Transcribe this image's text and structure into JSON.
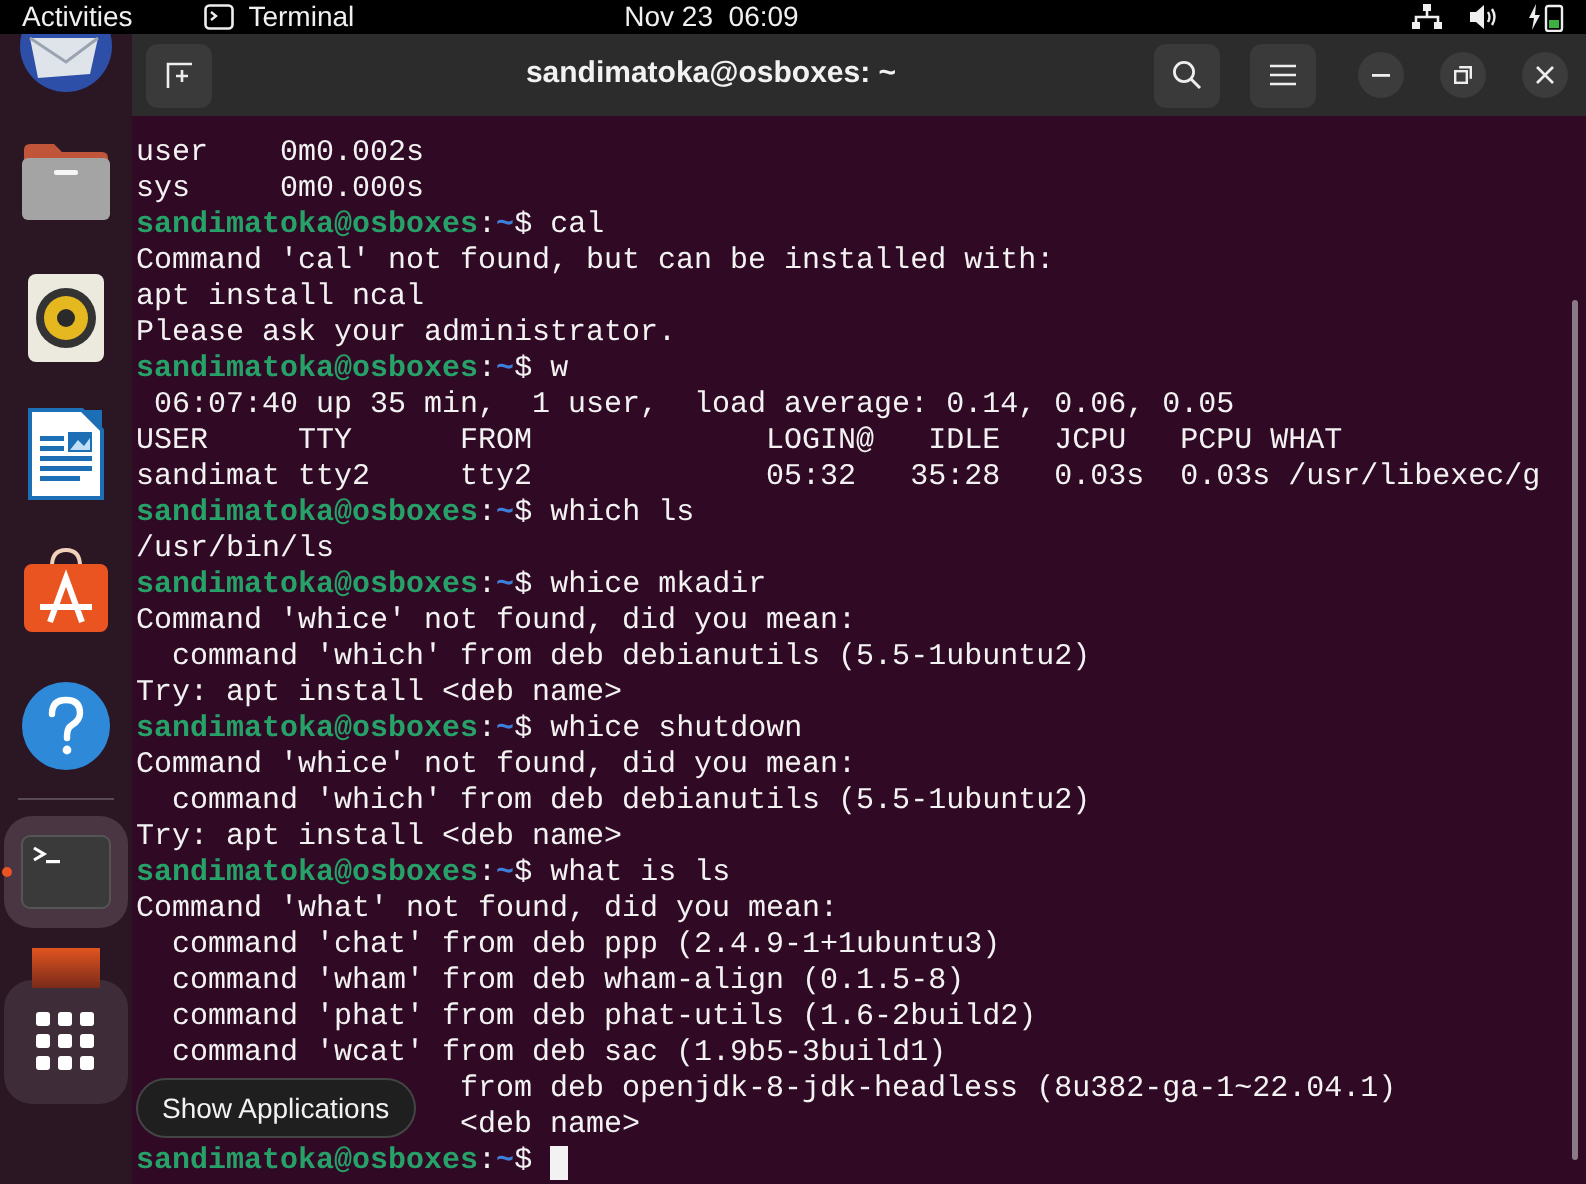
{
  "top_bar": {
    "activities": "Activities",
    "app_name": "Terminal",
    "clock": "Nov 23  06:09"
  },
  "dock": {
    "items": [
      {
        "kind": "mail",
        "running": false
      },
      {
        "kind": "files",
        "running": false
      },
      {
        "kind": "music",
        "running": false
      },
      {
        "kind": "writer",
        "running": false
      },
      {
        "kind": "software",
        "running": false
      },
      {
        "kind": "help",
        "running": false
      },
      {
        "kind": "terminal",
        "running": true
      },
      {
        "kind": "image",
        "running": false
      }
    ],
    "tooltip": "Show Applications"
  },
  "terminal": {
    "title": "sandimatoka@osboxes: ~",
    "lines": [
      {
        "kind": "output",
        "text": "user    0m0.002s"
      },
      {
        "kind": "output",
        "text": "sys     0m0.000s"
      },
      {
        "kind": "prompt",
        "user": "sandimatoka@osboxes",
        "separator": ":",
        "path": "~",
        "symbol": "$",
        "command": "cal"
      },
      {
        "kind": "output",
        "text": "Command 'cal' not found, but can be installed with:"
      },
      {
        "kind": "output",
        "text": "apt install ncal"
      },
      {
        "kind": "output",
        "text": "Please ask your administrator."
      },
      {
        "kind": "prompt",
        "user": "sandimatoka@osboxes",
        "separator": ":",
        "path": "~",
        "symbol": "$",
        "command": "w"
      },
      {
        "kind": "output",
        "text": " 06:07:40 up 35 min,  1 user,  load average: 0.14, 0.06, 0.05"
      },
      {
        "kind": "output",
        "text": "USER     TTY      FROM             LOGIN@   IDLE   JCPU   PCPU WHAT"
      },
      {
        "kind": "output",
        "text": "sandimat tty2     tty2             05:32   35:28   0.03s  0.03s /usr/libexec/g"
      },
      {
        "kind": "prompt",
        "user": "sandimatoka@osboxes",
        "separator": ":",
        "path": "~",
        "symbol": "$",
        "command": "which ls"
      },
      {
        "kind": "output",
        "text": "/usr/bin/ls"
      },
      {
        "kind": "prompt",
        "user": "sandimatoka@osboxes",
        "separator": ":",
        "path": "~",
        "symbol": "$",
        "command": "whice mkadir"
      },
      {
        "kind": "output",
        "text": "Command 'whice' not found, did you mean:"
      },
      {
        "kind": "output",
        "text": "  command 'which' from deb debianutils (5.5-1ubuntu2)"
      },
      {
        "kind": "output",
        "text": "Try: apt install <deb name>"
      },
      {
        "kind": "prompt",
        "user": "sandimatoka@osboxes",
        "separator": ":",
        "path": "~",
        "symbol": "$",
        "command": "whice shutdown"
      },
      {
        "kind": "output",
        "text": "Command 'whice' not found, did you mean:"
      },
      {
        "kind": "output",
        "text": "  command 'which' from deb debianutils (5.5-1ubuntu2)"
      },
      {
        "kind": "output",
        "text": "Try: apt install <deb name>"
      },
      {
        "kind": "prompt",
        "user": "sandimatoka@osboxes",
        "separator": ":",
        "path": "~",
        "symbol": "$",
        "command": "what is ls"
      },
      {
        "kind": "output",
        "text": "Command 'what' not found, did you mean:"
      },
      {
        "kind": "output",
        "text": "  command 'chat' from deb ppp (2.4.9-1+1ubuntu3)"
      },
      {
        "kind": "output",
        "text": "  command 'wham' from deb wham-align (0.1.5-8)"
      },
      {
        "kind": "output",
        "text": "  command 'phat' from deb phat-utils (1.6-2build2)"
      },
      {
        "kind": "output",
        "text": "  command 'wcat' from deb sac (1.9b5-3build1)"
      },
      {
        "kind": "covered",
        "text": "from deb openjdk-8-jdk-headless (8u382-ga-1~22.04.1)"
      },
      {
        "kind": "covered",
        "text": "<deb name>"
      },
      {
        "kind": "prompt",
        "user": "sandimatoka@osboxes",
        "separator": ":",
        "path": "~",
        "symbol": "$",
        "cursor": true
      }
    ]
  }
}
